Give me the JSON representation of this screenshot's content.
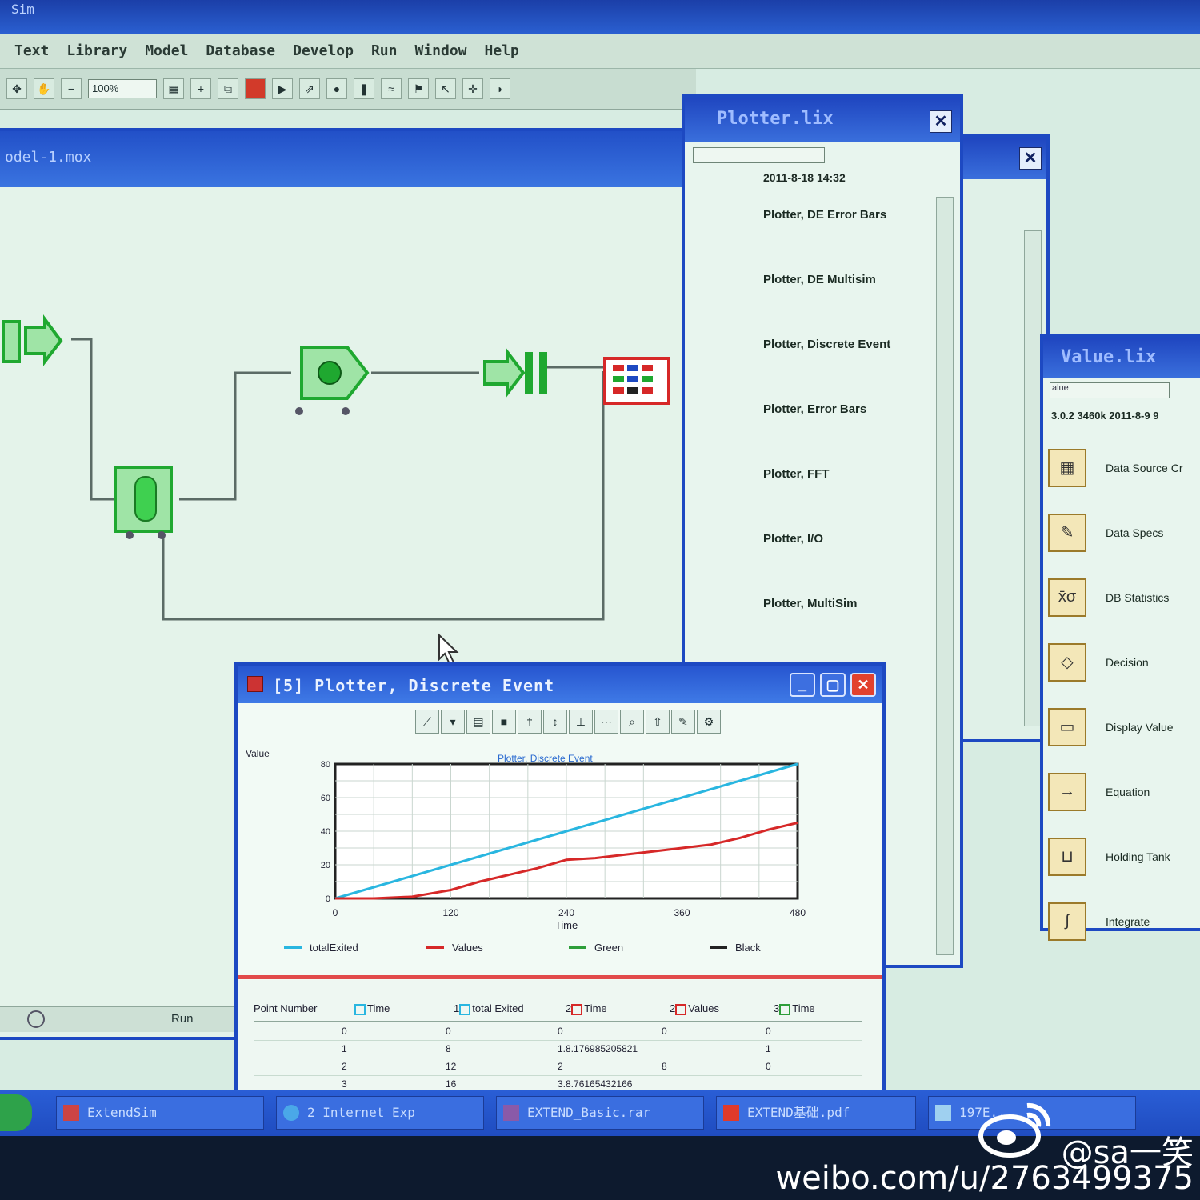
{
  "app": {
    "title_fragment": "Sim"
  },
  "menu": [
    "Text",
    "Library",
    "Model",
    "Database",
    "Develop",
    "Run",
    "Window",
    "Help"
  ],
  "toolbar": {
    "zoom": "100%"
  },
  "model_window": {
    "title": "odel-1.mox",
    "status_run": "Run"
  },
  "plotter_lib": {
    "title": "Plotter.lix",
    "date": "2011-8-18 14:32",
    "items": [
      "Plotter, DE Error Bars",
      "Plotter, DE Multisim",
      "Plotter, Discrete Event",
      "Plotter, Error Bars",
      "Plotter, FFT",
      "Plotter, I/O",
      "Plotter, MultiSim"
    ]
  },
  "value_lib": {
    "title": "Value.lix",
    "dropdown": "alue",
    "info": "3.0.2   3460k   2011-8-9 9",
    "items": [
      {
        "label": "Data Source Cr",
        "icon": "data-source-icon"
      },
      {
        "label": "Data Specs",
        "icon": "data-specs-icon"
      },
      {
        "label": "DB Statistics",
        "icon": "db-statistics-icon"
      },
      {
        "label": "Decision",
        "icon": "decision-icon"
      },
      {
        "label": "Display Value",
        "icon": "display-value-icon"
      },
      {
        "label": "Equation",
        "icon": "equation-icon"
      },
      {
        "label": "Holding Tank",
        "icon": "holding-tank-icon"
      },
      {
        "label": "Integrate",
        "icon": "integrate-icon"
      }
    ]
  },
  "plotter_window": {
    "title": "[5]   Plotter, Discrete Event",
    "y_label": "Value",
    "chart_title": "Plotter, Discrete Event",
    "table": {
      "headers": [
        "Point Number",
        "Time",
        "total Exited",
        "Time",
        "Values",
        "Time"
      ],
      "header_prefixes": [
        "1",
        "2",
        "2",
        "3"
      ],
      "rows": [
        [
          "0",
          "0",
          "0",
          "0",
          "0"
        ],
        [
          "1",
          "8",
          "1.8.176985205821",
          "1",
          ""
        ],
        [
          "2",
          "12",
          "2",
          "8",
          "0"
        ],
        [
          "3",
          "16",
          "3.8.76165432166",
          "",
          ""
        ]
      ]
    }
  },
  "chart_data": {
    "type": "line",
    "title": "Plotter, Discrete Event",
    "xlabel": "Time",
    "ylabel": "Value",
    "xlim": [
      0,
      480
    ],
    "ylim": [
      0,
      80
    ],
    "xticks": [
      "0",
      "120",
      "240",
      "360",
      "480"
    ],
    "yticks": [
      "0",
      "20",
      "40",
      "60",
      "80"
    ],
    "grid": true,
    "legend_placement": "bottom",
    "series": [
      {
        "name": "totalExited",
        "color": "#29b6e0",
        "x": [
          0,
          60,
          120,
          180,
          240,
          300,
          360,
          420,
          480
        ],
        "y": [
          0,
          10,
          20,
          30,
          40,
          50,
          60,
          70,
          80
        ]
      },
      {
        "name": "Values",
        "color": "#d62828",
        "x": [
          0,
          40,
          80,
          100,
          120,
          150,
          180,
          210,
          240,
          270,
          300,
          330,
          360,
          390,
          420,
          450,
          480
        ],
        "y": [
          0,
          0,
          1,
          3,
          5,
          10,
          14,
          18,
          23,
          24,
          26,
          28,
          30,
          32,
          36,
          41,
          45
        ]
      },
      {
        "name": "Green",
        "color": "#2e9e3a",
        "x": [],
        "y": []
      },
      {
        "name": "Black",
        "color": "#222222",
        "x": [],
        "y": []
      }
    ]
  },
  "taskbar": {
    "tasks": [
      "ExtendSim",
      "2 Internet Exp",
      "EXTEND_Basic.rar",
      "EXTEND基础.pdf",
      "197E..."
    ]
  },
  "watermark": {
    "handle": "@sa一笑",
    "url": "weibo.com/u/2763499375"
  },
  "colors": {
    "title_blue": "#1d49c2",
    "screen_tint": "#d7ece2",
    "block_green": "#1fa830",
    "block_red": "#d62828"
  }
}
